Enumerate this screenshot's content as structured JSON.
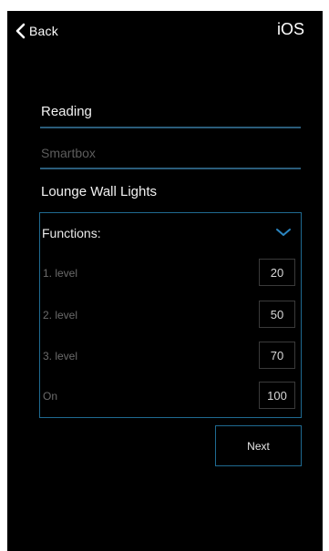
{
  "nav": {
    "back_label": "Back",
    "platform_label": "iOS"
  },
  "form": {
    "location_value": "Reading",
    "hub_placeholder": "Smartbox",
    "device_name": "Lounge Wall Lights"
  },
  "functions": {
    "header": "Functions:",
    "rows": [
      {
        "label": "1. level",
        "value": "20"
      },
      {
        "label": "2. level",
        "value": "50"
      },
      {
        "label": "3. level",
        "value": "70"
      },
      {
        "label": "On",
        "value": "100"
      }
    ]
  },
  "actions": {
    "next_label": "Next"
  },
  "icons": {
    "back": "chevron-left-icon",
    "expand": "chevron-down-icon"
  },
  "colors": {
    "background": "#000000",
    "accent": "#1f6a91",
    "text": "#f2f2f2",
    "muted": "#6b6b6b"
  }
}
